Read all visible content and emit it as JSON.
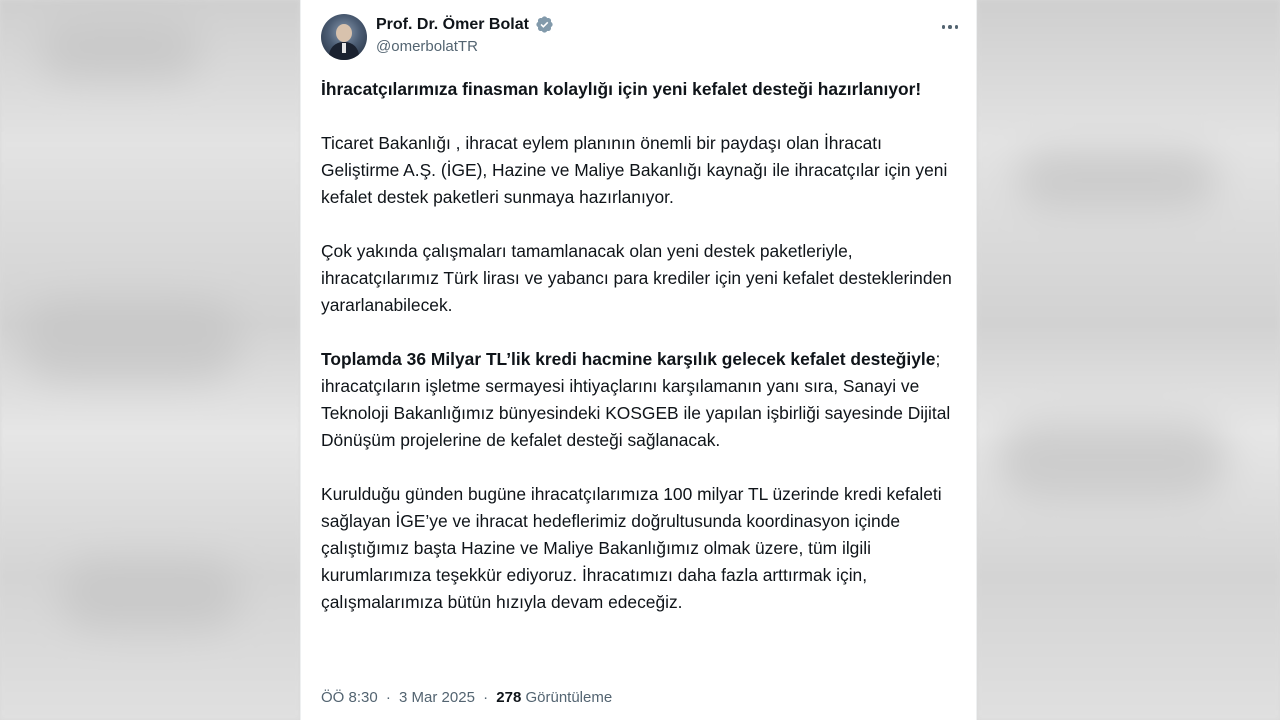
{
  "tweet": {
    "author": {
      "display_name": "Prof. Dr. Ömer Bolat",
      "handle": "@omerbolatTR"
    },
    "paragraphs": {
      "p1": "İhracatçılarımıza finasman kolaylığı için yeni kefalet desteği hazırlanıyor!",
      "p2": "Ticaret Bakanlığı , ihracat eylem planının önemli bir paydaşı olan İhracatı Geliştirme A.Ş. (İGE), Hazine ve Maliye Bakanlığı kaynağı ile ihracatçılar için yeni kefalet destek paketleri sunmaya hazırlanıyor.",
      "p3": "Çok yakında çalışmaları tamamlanacak olan yeni destek paketleriyle, ihracatçılarımız Türk lirası ve yabancı para krediler için yeni kefalet desteklerinden yararlanabilecek.",
      "p4_bold": "Toplamda 36 Milyar TL’lik kredi hacmine karşılık gelecek kefalet desteğiyle",
      "p4_rest": "; ihracatçıların işletme sermayesi ihtiyaçlarını karşılamanın yanı sıra, Sanayi ve Teknoloji Bakanlığımız bünyesindeki KOSGEB ile yapılan işbirliği sayesinde Dijital Dönüşüm projelerine de kefalet desteği sağlanacak.",
      "p5": "Kurulduğu günden bugüne ihracatçılarımıza 100 milyar TL üzerinde kredi kefaleti sağlayan İGE’ye ve ihracat hedeflerimiz doğrultusunda koordinasyon içinde çalıştığımız başta Hazine ve Maliye Bakanlığımız olmak üzere, tüm ilgili kurumlarımıza teşekkür ediyoruz. İhracatımızı daha fazla arttırmak için, çalışmalarımıza bütün hızıyla devam edeceğiz."
    },
    "meta": {
      "time": "ÖÖ 8:30",
      "separator": "·",
      "date": "3 Mar 2025",
      "views_count": "278",
      "views_label": "Görüntüleme"
    },
    "colors": {
      "text": "#0f1419",
      "secondary": "#536471",
      "verified_badge": "#829aab"
    },
    "icons": {
      "verified": "verified-badge-icon",
      "more": "more-options-icon"
    }
  }
}
